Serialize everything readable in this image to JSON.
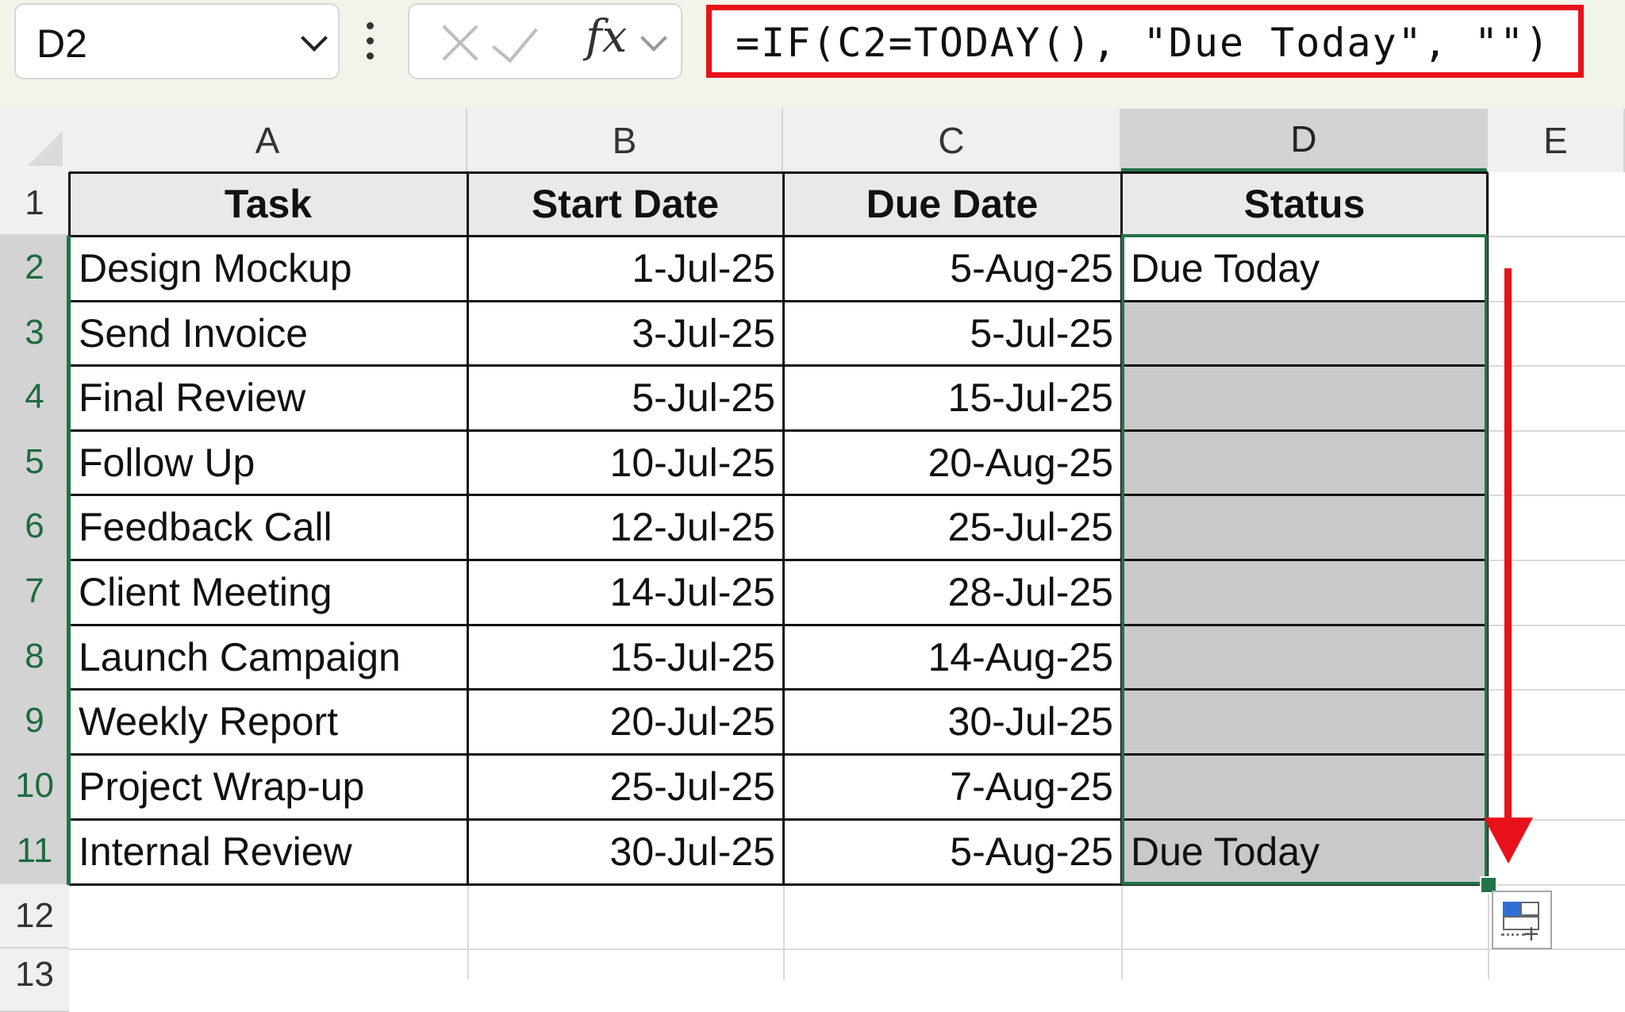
{
  "formula_bar": {
    "name_box": "D2",
    "fx_label": "fx",
    "formula": "=IF(C2=TODAY(), \"Due Today\", \"\")"
  },
  "columns": [
    "A",
    "B",
    "C",
    "D",
    "E"
  ],
  "rows": [
    "1",
    "2",
    "3",
    "4",
    "5",
    "6",
    "7",
    "8",
    "9",
    "10",
    "11",
    "12",
    "13"
  ],
  "table": {
    "headers": [
      "Task",
      "Start Date",
      "Due Date",
      "Status"
    ],
    "rows": [
      {
        "task": "Design Mockup",
        "start": "1-Jul-25",
        "due": "5-Aug-25",
        "status": "Due Today"
      },
      {
        "task": "Send Invoice",
        "start": "3-Jul-25",
        "due": "5-Jul-25",
        "status": ""
      },
      {
        "task": "Final Review",
        "start": "5-Jul-25",
        "due": "15-Jul-25",
        "status": ""
      },
      {
        "task": "Follow Up",
        "start": "10-Jul-25",
        "due": "20-Aug-25",
        "status": ""
      },
      {
        "task": "Feedback Call",
        "start": "12-Jul-25",
        "due": "25-Jul-25",
        "status": ""
      },
      {
        "task": "Client Meeting",
        "start": "14-Jul-25",
        "due": "28-Jul-25",
        "status": ""
      },
      {
        "task": "Launch Campaign",
        "start": "15-Jul-25",
        "due": "14-Aug-25",
        "status": ""
      },
      {
        "task": "Weekly Report",
        "start": "20-Jul-25",
        "due": "30-Jul-25",
        "status": ""
      },
      {
        "task": "Project Wrap-up",
        "start": "25-Jul-25",
        "due": "7-Aug-25",
        "status": ""
      },
      {
        "task": "Internal Review",
        "start": "30-Jul-25",
        "due": "5-Aug-25",
        "status": "Due Today"
      }
    ]
  },
  "colors": {
    "highlight_red": "#e8111a",
    "selection_green": "#217346",
    "selected_fill": "#c9c9c9",
    "header_fill": "#e9e9e9"
  },
  "icons": [
    "chevron-down-icon",
    "more-options-icon",
    "cancel-x-icon",
    "enter-check-icon",
    "insert-function-icon",
    "quick-analysis-icon"
  ]
}
